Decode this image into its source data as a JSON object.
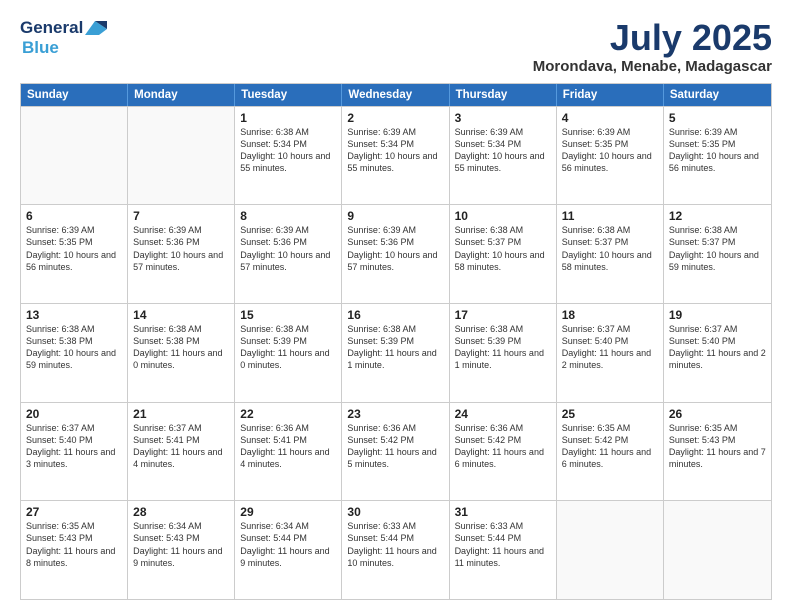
{
  "logo": {
    "line1": "General",
    "line2": "Blue"
  },
  "title": "July 2025",
  "subtitle": "Morondava, Menabe, Madagascar",
  "header": {
    "days": [
      "Sunday",
      "Monday",
      "Tuesday",
      "Wednesday",
      "Thursday",
      "Friday",
      "Saturday"
    ]
  },
  "weeks": [
    [
      {
        "day": "",
        "empty": true
      },
      {
        "day": "",
        "empty": true
      },
      {
        "day": "1",
        "sunrise": "6:38 AM",
        "sunset": "5:34 PM",
        "daylight": "10 hours and 55 minutes."
      },
      {
        "day": "2",
        "sunrise": "6:39 AM",
        "sunset": "5:34 PM",
        "daylight": "10 hours and 55 minutes."
      },
      {
        "day": "3",
        "sunrise": "6:39 AM",
        "sunset": "5:34 PM",
        "daylight": "10 hours and 55 minutes."
      },
      {
        "day": "4",
        "sunrise": "6:39 AM",
        "sunset": "5:35 PM",
        "daylight": "10 hours and 56 minutes."
      },
      {
        "day": "5",
        "sunrise": "6:39 AM",
        "sunset": "5:35 PM",
        "daylight": "10 hours and 56 minutes."
      }
    ],
    [
      {
        "day": "6",
        "sunrise": "6:39 AM",
        "sunset": "5:35 PM",
        "daylight": "10 hours and 56 minutes."
      },
      {
        "day": "7",
        "sunrise": "6:39 AM",
        "sunset": "5:36 PM",
        "daylight": "10 hours and 57 minutes."
      },
      {
        "day": "8",
        "sunrise": "6:39 AM",
        "sunset": "5:36 PM",
        "daylight": "10 hours and 57 minutes."
      },
      {
        "day": "9",
        "sunrise": "6:39 AM",
        "sunset": "5:36 PM",
        "daylight": "10 hours and 57 minutes."
      },
      {
        "day": "10",
        "sunrise": "6:38 AM",
        "sunset": "5:37 PM",
        "daylight": "10 hours and 58 minutes."
      },
      {
        "day": "11",
        "sunrise": "6:38 AM",
        "sunset": "5:37 PM",
        "daylight": "10 hours and 58 minutes."
      },
      {
        "day": "12",
        "sunrise": "6:38 AM",
        "sunset": "5:37 PM",
        "daylight": "10 hours and 59 minutes."
      }
    ],
    [
      {
        "day": "13",
        "sunrise": "6:38 AM",
        "sunset": "5:38 PM",
        "daylight": "10 hours and 59 minutes."
      },
      {
        "day": "14",
        "sunrise": "6:38 AM",
        "sunset": "5:38 PM",
        "daylight": "11 hours and 0 minutes."
      },
      {
        "day": "15",
        "sunrise": "6:38 AM",
        "sunset": "5:39 PM",
        "daylight": "11 hours and 0 minutes."
      },
      {
        "day": "16",
        "sunrise": "6:38 AM",
        "sunset": "5:39 PM",
        "daylight": "11 hours and 1 minute."
      },
      {
        "day": "17",
        "sunrise": "6:38 AM",
        "sunset": "5:39 PM",
        "daylight": "11 hours and 1 minute."
      },
      {
        "day": "18",
        "sunrise": "6:37 AM",
        "sunset": "5:40 PM",
        "daylight": "11 hours and 2 minutes."
      },
      {
        "day": "19",
        "sunrise": "6:37 AM",
        "sunset": "5:40 PM",
        "daylight": "11 hours and 2 minutes."
      }
    ],
    [
      {
        "day": "20",
        "sunrise": "6:37 AM",
        "sunset": "5:40 PM",
        "daylight": "11 hours and 3 minutes."
      },
      {
        "day": "21",
        "sunrise": "6:37 AM",
        "sunset": "5:41 PM",
        "daylight": "11 hours and 4 minutes."
      },
      {
        "day": "22",
        "sunrise": "6:36 AM",
        "sunset": "5:41 PM",
        "daylight": "11 hours and 4 minutes."
      },
      {
        "day": "23",
        "sunrise": "6:36 AM",
        "sunset": "5:42 PM",
        "daylight": "11 hours and 5 minutes."
      },
      {
        "day": "24",
        "sunrise": "6:36 AM",
        "sunset": "5:42 PM",
        "daylight": "11 hours and 6 minutes."
      },
      {
        "day": "25",
        "sunrise": "6:35 AM",
        "sunset": "5:42 PM",
        "daylight": "11 hours and 6 minutes."
      },
      {
        "day": "26",
        "sunrise": "6:35 AM",
        "sunset": "5:43 PM",
        "daylight": "11 hours and 7 minutes."
      }
    ],
    [
      {
        "day": "27",
        "sunrise": "6:35 AM",
        "sunset": "5:43 PM",
        "daylight": "11 hours and 8 minutes."
      },
      {
        "day": "28",
        "sunrise": "6:34 AM",
        "sunset": "5:43 PM",
        "daylight": "11 hours and 9 minutes."
      },
      {
        "day": "29",
        "sunrise": "6:34 AM",
        "sunset": "5:44 PM",
        "daylight": "11 hours and 9 minutes."
      },
      {
        "day": "30",
        "sunrise": "6:33 AM",
        "sunset": "5:44 PM",
        "daylight": "11 hours and 10 minutes."
      },
      {
        "day": "31",
        "sunrise": "6:33 AM",
        "sunset": "5:44 PM",
        "daylight": "11 hours and 11 minutes."
      },
      {
        "day": "",
        "empty": true
      },
      {
        "day": "",
        "empty": true
      }
    ]
  ]
}
